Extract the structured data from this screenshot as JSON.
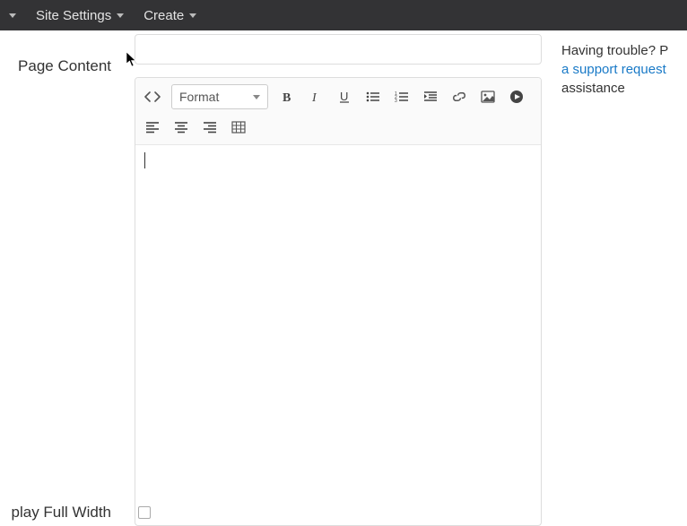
{
  "topbar": {
    "item1_label": "Site Settings",
    "item2_label": "Create"
  },
  "left": {
    "page_content_label": "Page Content",
    "full_width_label": "play Full Width"
  },
  "editor": {
    "format_label": "Format",
    "body_content": ""
  },
  "help": {
    "line1": "Having trouble? P",
    "link": "a support request",
    "line2": "assistance"
  }
}
